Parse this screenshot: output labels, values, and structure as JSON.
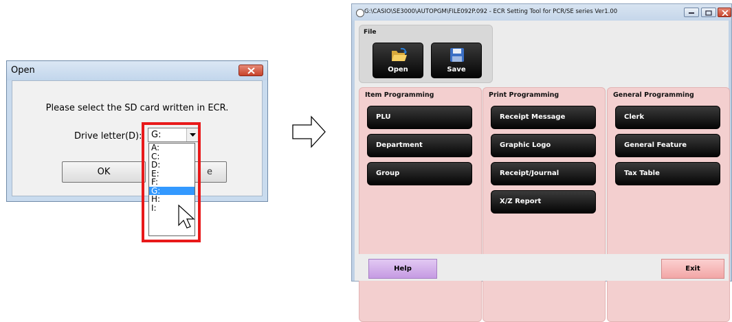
{
  "open_dialog": {
    "title": "Open",
    "message": "Please select the SD card written in ECR.",
    "drive_label": "Drive letter(D):",
    "selected_drive": "G:",
    "drive_options": [
      "A:",
      "C:",
      "D:",
      "E:",
      "F:",
      "G:",
      "H:",
      "I:"
    ],
    "ok_label": "OK",
    "cancel_label_visible": "e"
  },
  "ecr_window": {
    "title": "G:\\CASIO\\SE3000\\AUTOPGM\\FILE092P.092 - ECR Setting Tool for PCR/SE series Ver1.00",
    "file_panel": {
      "title": "File",
      "open_label": "Open",
      "save_label": "Save"
    },
    "item_programming": {
      "title": "Item Programming",
      "buttons": [
        "PLU",
        "Department",
        "Group"
      ]
    },
    "print_programming": {
      "title": "Print Programming",
      "buttons": [
        "Receipt Message",
        "Graphic Logo",
        "Receipt/Journal",
        "X/Z Report"
      ]
    },
    "general_programming": {
      "title": "General Programming",
      "buttons": [
        "Clerk",
        "General Feature",
        "Tax Table"
      ]
    },
    "help_label": "Help",
    "exit_label": "Exit"
  },
  "colors": {
    "highlight_box": "#e8191a",
    "group_panel_bg": "#f3cfcf",
    "help_button": "#d4b2ec",
    "exit_button": "#f5b8b8",
    "dark_button": "#111111"
  }
}
